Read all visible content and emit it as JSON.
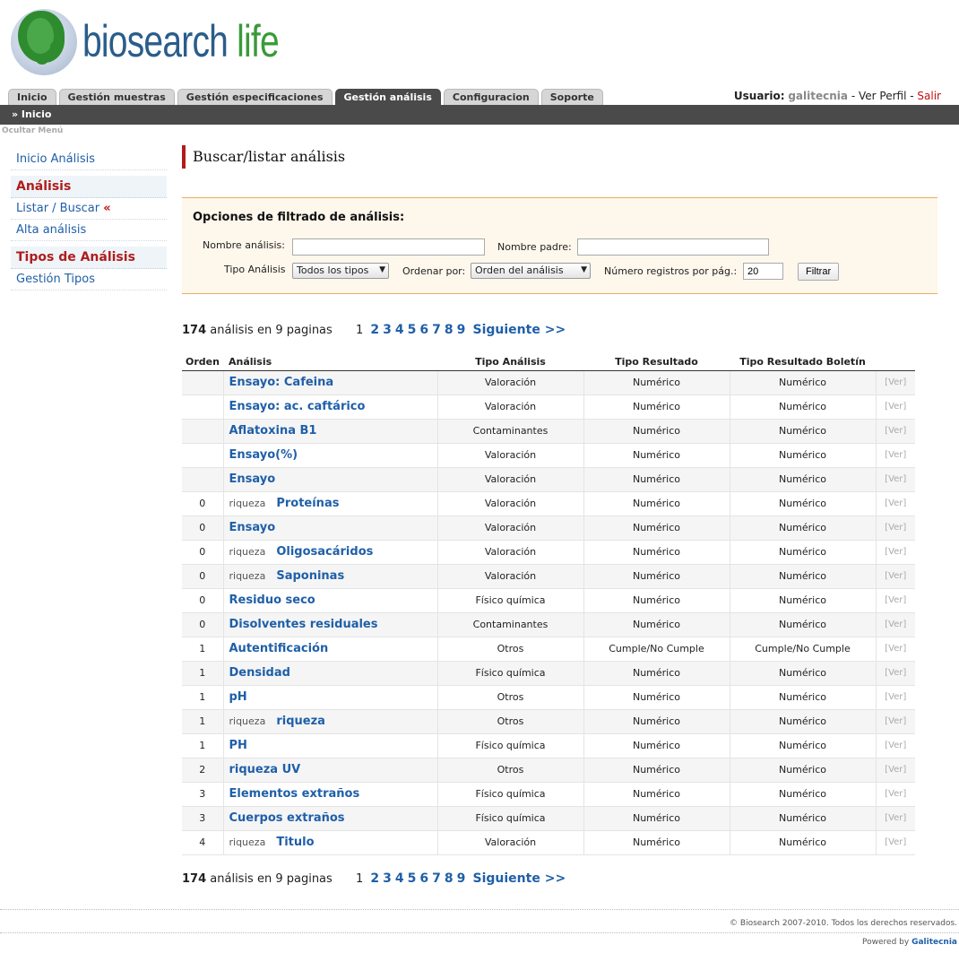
{
  "logo": {
    "word1": "biosearch",
    "word2": "life"
  },
  "tabs": [
    "Inicio",
    "Gestión muestras",
    "Gestión especificaciones",
    "Gestión análisis",
    "Configuracion",
    "Soporte"
  ],
  "active_tab": "Gestión análisis",
  "user": {
    "label": "Usuario:",
    "name": "galitecnia",
    "sep1": "-",
    "profile": "Ver Perfil",
    "sep2": "-",
    "logout": "Salir"
  },
  "breadcrumb": "» Inicio",
  "hide_menu": "Ocultar Menú",
  "sidebar": {
    "home": "Inicio Análisis",
    "section1": "Análisis",
    "list": "Listar / Buscar",
    "list_marker": "«",
    "add": "Alta análisis",
    "section2": "Tipos de Análisis",
    "manage_types": "Gestión Tipos"
  },
  "page_title": "Buscar/listar análisis",
  "filter": {
    "title": "Opciones de filtrado de análisis:",
    "name_label": "Nombre análisis:",
    "name_value": "",
    "parent_label": "Nombre padre:",
    "parent_value": "",
    "type_label": "Tipo Análisis",
    "type_value": "Todos los tipos",
    "order_label": "Ordenar por:",
    "order_value": "Orden del análisis",
    "perpage_label": "Número registros por pág.:",
    "perpage_value": "20",
    "button": "Filtrar"
  },
  "pager": {
    "count": "174",
    "text": "análisis en 9 paginas",
    "current": "1",
    "pages": [
      "2",
      "3",
      "4",
      "5",
      "6",
      "7",
      "8",
      "9"
    ],
    "next": "Siguiente >>"
  },
  "table": {
    "headers": [
      "Orden",
      "Análisis",
      "Tipo Análisis",
      "Tipo Resultado",
      "Tipo Resultado Boletín",
      ""
    ],
    "rows": [
      {
        "orden": "",
        "pre": "",
        "name": "Ensayo: Cafeina",
        "tipo": "Valoración",
        "res": "Numérico",
        "bol": "Numérico"
      },
      {
        "orden": "",
        "pre": "",
        "name": "Ensayo: ac. caftárico",
        "tipo": "Valoración",
        "res": "Numérico",
        "bol": "Numérico"
      },
      {
        "orden": "",
        "pre": "",
        "name": "Aflatoxina B1",
        "tipo": "Contaminantes",
        "res": "Numérico",
        "bol": "Numérico"
      },
      {
        "orden": "",
        "pre": "",
        "name": "Ensayo(%)",
        "tipo": "Valoración",
        "res": "Numérico",
        "bol": "Numérico"
      },
      {
        "orden": "",
        "pre": "",
        "name": "Ensayo",
        "tipo": "Valoración",
        "res": "Numérico",
        "bol": "Numérico"
      },
      {
        "orden": "0",
        "pre": "riqueza",
        "name": "Proteínas",
        "tipo": "Valoración",
        "res": "Numérico",
        "bol": "Numérico"
      },
      {
        "orden": "0",
        "pre": "",
        "name": "Ensayo",
        "tipo": "Valoración",
        "res": "Numérico",
        "bol": "Numérico"
      },
      {
        "orden": "0",
        "pre": "riqueza",
        "name": "Oligosacáridos",
        "tipo": "Valoración",
        "res": "Numérico",
        "bol": "Numérico"
      },
      {
        "orden": "0",
        "pre": "riqueza",
        "name": "Saponinas",
        "tipo": "Valoración",
        "res": "Numérico",
        "bol": "Numérico"
      },
      {
        "orden": "0",
        "pre": "",
        "name": "Residuo seco",
        "tipo": "Físico química",
        "res": "Numérico",
        "bol": "Numérico"
      },
      {
        "orden": "0",
        "pre": "",
        "name": "Disolventes residuales",
        "tipo": "Contaminantes",
        "res": "Numérico",
        "bol": "Numérico"
      },
      {
        "orden": "1",
        "pre": "",
        "name": "Autentificación",
        "tipo": "Otros",
        "res": "Cumple/No Cumple",
        "bol": "Cumple/No Cumple"
      },
      {
        "orden": "1",
        "pre": "",
        "name": "Densidad",
        "tipo": "Físico química",
        "res": "Numérico",
        "bol": "Numérico"
      },
      {
        "orden": "1",
        "pre": "",
        "name": "pH",
        "tipo": "Otros",
        "res": "Numérico",
        "bol": "Numérico"
      },
      {
        "orden": "1",
        "pre": "riqueza",
        "name": "riqueza",
        "tipo": "Otros",
        "res": "Numérico",
        "bol": "Numérico"
      },
      {
        "orden": "1",
        "pre": "",
        "name": "PH",
        "tipo": "Físico química",
        "res": "Numérico",
        "bol": "Numérico"
      },
      {
        "orden": "2",
        "pre": "",
        "name": "riqueza UV",
        "tipo": "Otros",
        "res": "Numérico",
        "bol": "Numérico"
      },
      {
        "orden": "3",
        "pre": "",
        "name": "Elementos extraños",
        "tipo": "Físico química",
        "res": "Numérico",
        "bol": "Numérico"
      },
      {
        "orden": "3",
        "pre": "",
        "name": "Cuerpos extraños",
        "tipo": "Físico química",
        "res": "Numérico",
        "bol": "Numérico"
      },
      {
        "orden": "4",
        "pre": "riqueza",
        "name": "Titulo",
        "tipo": "Valoración",
        "res": "Numérico",
        "bol": "Numérico"
      }
    ],
    "view_label": "[Ver]"
  },
  "footer": {
    "copyright": "© Biosearch 2007-2010. Todos los derechos reservados.",
    "powered": "Powered by",
    "powered_by": "Galitecnia"
  }
}
